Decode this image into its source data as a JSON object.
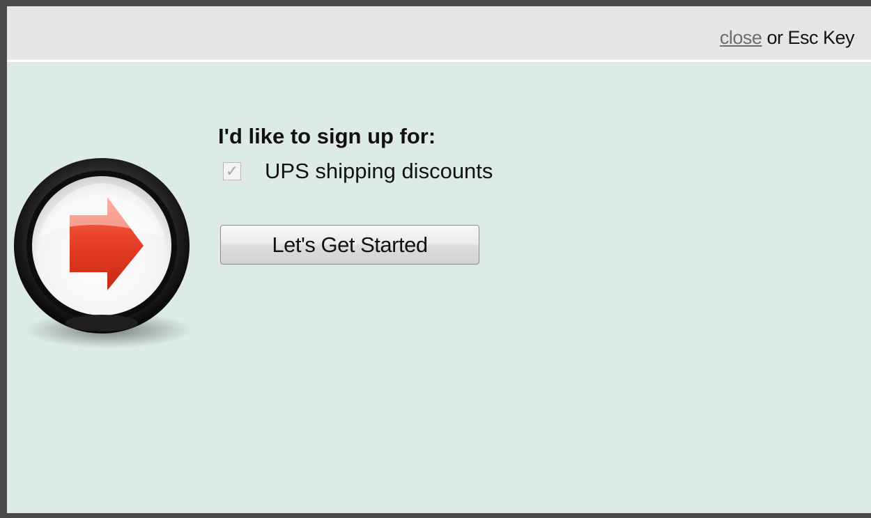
{
  "header": {
    "close_link": "close",
    "close_suffix": " or Esc Key"
  },
  "signup": {
    "heading": "I'd like to sign up for:",
    "option_label": "UPS shipping discounts",
    "option_checked": true,
    "checkbox_glyph": "✓",
    "button_label": "Let's Get Started"
  },
  "badge": {
    "icon": "red-right-arrow-icon",
    "arrow_color": "#e0402a"
  },
  "colors": {
    "content_background": "#dcebe4",
    "header_background": "#e6e6e6",
    "frame_border": "#4a4a4a"
  }
}
